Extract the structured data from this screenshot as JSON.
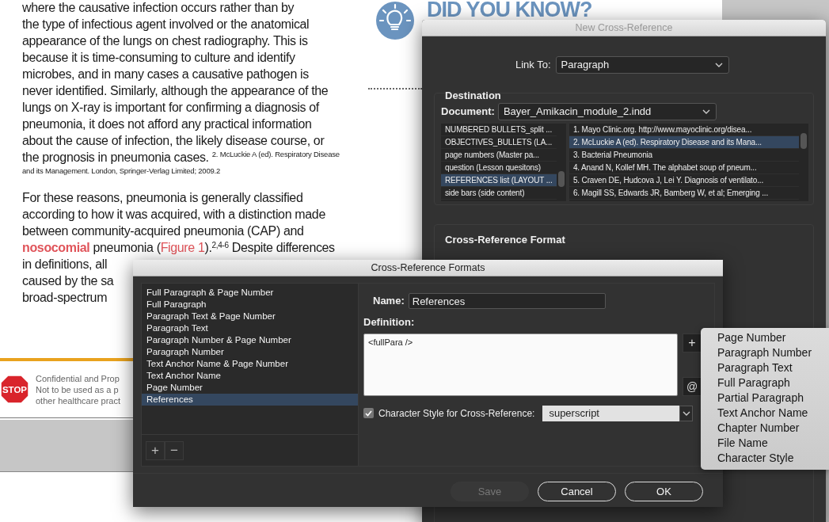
{
  "document": {
    "paragraph_1": {
      "lines": [
        "where the causative infection occurs rather than by",
        "the type of infectious agent involved or the anatomical",
        "appearance of the lungs on chest radiography. This is",
        "because it is time-consuming to culture and identify",
        "microbes, and in many cases a causative pathogen is",
        "never identified. Similarly, although the appearance of the",
        "lungs on X-ray is important for confirming a diagnosis of",
        "pneumonia, it does not afford any practical information",
        "about the cause of infection, the likely disease course, or",
        "the prognosis in pneumonia cases."
      ],
      "footnote_lines": [
        "2. McLuckie A (ed). Respiratory Disease",
        "and its Management. London, Springer-Verlag Limited; 2009.2"
      ]
    },
    "paragraph_2": {
      "lines": [
        [
          {
            "kind": "plain",
            "text": "For these reasons, pneumonia is generally classified"
          }
        ],
        [
          {
            "kind": "plain",
            "text": "according to how it was acquired, with a distinction made"
          }
        ],
        [
          {
            "kind": "plain",
            "text": "between community-acquired pneumonia (CAP) and"
          }
        ],
        [
          {
            "kind": "term",
            "text": "nosocomial"
          },
          {
            "kind": "plain",
            "text": " pneumonia ("
          },
          {
            "kind": "link",
            "text": "Figure 1"
          },
          {
            "kind": "plain",
            "text": ").$^{2,4-6}$ Despite differences"
          }
        ],
        [
          {
            "kind": "plain",
            "text": "in definitions, all"
          }
        ],
        [
          {
            "kind": "plain",
            "text": "caused by the sa"
          }
        ],
        [
          {
            "kind": "plain",
            "text": "broad-spectrum"
          }
        ]
      ]
    },
    "sidebar_heading": "DID YOU KNOW?",
    "banner": {
      "sign": "STOP",
      "lines": [
        "Confidential and Prop",
        "Not to be used as a p",
        "other healthcare pract"
      ]
    }
  },
  "new_cross_reference": {
    "title": "New Cross-Reference",
    "link_to_label": "Link To:",
    "link_to_value": "Paragraph",
    "destination_label": "Destination",
    "document_label": "Document:",
    "document_value": "Bayer_Amikacin_module_2.indd",
    "styles": [
      {
        "label": "NUMBERED BULLETS_split ...",
        "selected": false
      },
      {
        "label": "OBJECTIVES_BULLETS (LA...",
        "selected": false
      },
      {
        "label": "page numbers (Master pa...",
        "selected": false
      },
      {
        "label": "question (Lesson quesitons)",
        "selected": false
      },
      {
        "label": "REFERENCES list (LAYOUT ...",
        "selected": true
      },
      {
        "label": "side bars (side content)",
        "selected": false
      }
    ],
    "paragraphs": [
      {
        "label": "1. Mayo Clinic.org. http://www.mayoclinic.org/disea...",
        "selected": false
      },
      {
        "label": "2. McLuckie A (ed). Respiratory Disease and its Mana...",
        "selected": true
      },
      {
        "label": "3. Bacterial Pneumonia",
        "selected": false
      },
      {
        "label": "4. Anand N, Kollef MH. The alphabet soup of pneum...",
        "selected": false
      },
      {
        "label": "5. Craven DE, Hudcova J, Lei Y. Diagnosis of ventilato...",
        "selected": false
      },
      {
        "label": "6. Magill SS, Edwards JR, Bamberg W,  et al; Emerging ...",
        "selected": false
      }
    ],
    "format_label": "Cross-Reference Format"
  },
  "cross_reference_formats": {
    "title": "Cross-Reference Formats",
    "formats": [
      {
        "label": "Full Paragraph & Page Number",
        "selected": false
      },
      {
        "label": "Full Paragraph",
        "selected": false
      },
      {
        "label": "Paragraph Text & Page Number",
        "selected": false
      },
      {
        "label": "Paragraph Text",
        "selected": false
      },
      {
        "label": "Paragraph Number & Page Number",
        "selected": false
      },
      {
        "label": "Paragraph Number",
        "selected": false
      },
      {
        "label": "Text Anchor Name & Page Number",
        "selected": false
      },
      {
        "label": "Text Anchor Name",
        "selected": false
      },
      {
        "label": "Page Number",
        "selected": false
      },
      {
        "label": "References",
        "selected": true
      }
    ],
    "add_symbol": "+",
    "remove_symbol": "−",
    "name_label": "Name:",
    "name_value": "References",
    "definition_label": "Definition:",
    "definition_value": "<fullPara />",
    "insert_symbol": "+",
    "special_symbol": "@",
    "character_style": {
      "checked": true,
      "label": "Character Style for Cross-Reference:",
      "value": "superscript"
    },
    "buttons": [
      {
        "label": "Save",
        "disabled": true
      },
      {
        "label": "Cancel",
        "disabled": false
      },
      {
        "label": "OK",
        "disabled": false
      }
    ]
  },
  "building_blocks_menu": {
    "items": [
      "Page Number",
      "Paragraph Number",
      "Paragraph Text",
      "Full Paragraph",
      "Partial Paragraph",
      "Text Anchor Name",
      "Chapter Number",
      "File Name",
      "Character Style"
    ]
  }
}
